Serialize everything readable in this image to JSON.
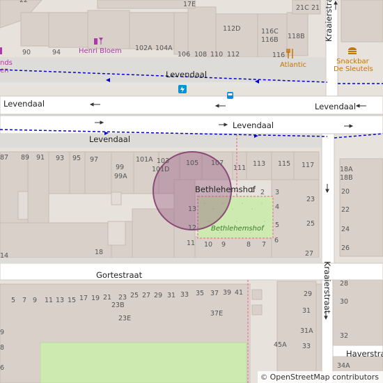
{
  "streets": {
    "levendaal_1": "Levendaal",
    "levendaal_2": "Levendaal",
    "levendaal_3": "Levendaal",
    "levendaal_4": "Levendaal",
    "levendaal_5": "Levendaal",
    "gortestraat": "Gortestraat",
    "kraaierstraat_top": "Kraaierstraat",
    "kraaierstraat_bottom": "Kraaierstraat",
    "haverstraat": "Haverstraat",
    "bethlehemshof": "Bethlehemshof",
    "bethlehemshof_park": "Bethlehemshof"
  },
  "pois": {
    "henri_bloem": "Henri Bloem",
    "atlantic": "Atlantic",
    "snackbar_line1": "Snackbar",
    "snackbar_line2": "De Sleutels",
    "left_poi_line1": "nds",
    "left_poi_line2": "en"
  },
  "house_numbers": {
    "n22": "22",
    "n17E": "17E",
    "n21C": "21C",
    "n21": "21",
    "n112D": "112D",
    "n116C": "116C",
    "n116B": "116B",
    "n118B": "118B",
    "n90": "90",
    "n94": "94",
    "n102A": "102A",
    "n104A": "104A",
    "n106": "106",
    "n108": "108",
    "n110": "110",
    "n112": "112",
    "n116": "116",
    "n87": "87",
    "n89": "89",
    "n91": "91",
    "n93": "93",
    "n95": "95",
    "n97": "97",
    "n99": "99",
    "n99A": "99A",
    "n101A": "101A",
    "n103": "103",
    "n101D": "101D",
    "n105": "105",
    "n107": "107",
    "n111": "111",
    "n113": "113",
    "n115": "115",
    "n117": "117",
    "n18A": "18A",
    "n18B": "18B",
    "n20": "20",
    "n22b": "22",
    "n24": "24",
    "n26": "26",
    "n1": "1",
    "n2": "2",
    "n3": "3",
    "n4": "4",
    "n5": "5",
    "n6": "6",
    "n13": "13",
    "n12": "12",
    "n11": "11",
    "n10": "10",
    "n9": "9",
    "n8": "8",
    "n7": "7",
    "n23": "23",
    "n25": "25",
    "n27": "27",
    "n18": "18",
    "n14": "14",
    "row_bottom": [
      "5",
      "7",
      "9",
      "11",
      "13",
      "15",
      "17",
      "19",
      "21",
      "23",
      "25",
      "27",
      "29",
      "31",
      "33",
      "35",
      "37",
      "39",
      "41"
    ],
    "n23B": "23B",
    "n23E": "23E",
    "n37E": "37E",
    "n29": "29",
    "n31": "31",
    "n31A": "31A",
    "n33": "33",
    "n45A": "45A",
    "n28": "28",
    "n30": "30",
    "n32": "32",
    "n34A": "34A",
    "n9left": "9",
    "n8left": "8",
    "n6left": "6"
  },
  "attribution": {
    "symbol": "©",
    "text": "OpenStreetMap contributors"
  },
  "colors": {
    "background": "#e8e2dc",
    "building": "#d9d0c9",
    "road": "#ffffff",
    "park": "#cdebb0",
    "bus_route": "#0000cc",
    "highlight_circle": "#8b4a77",
    "poi_pink": "#ac39ac",
    "poi_orange": "#c77400"
  },
  "icons": [
    "wine-shop-icon",
    "restaurant-icon",
    "fast-food-icon",
    "charging-station-icon",
    "bus-stop-icon"
  ]
}
